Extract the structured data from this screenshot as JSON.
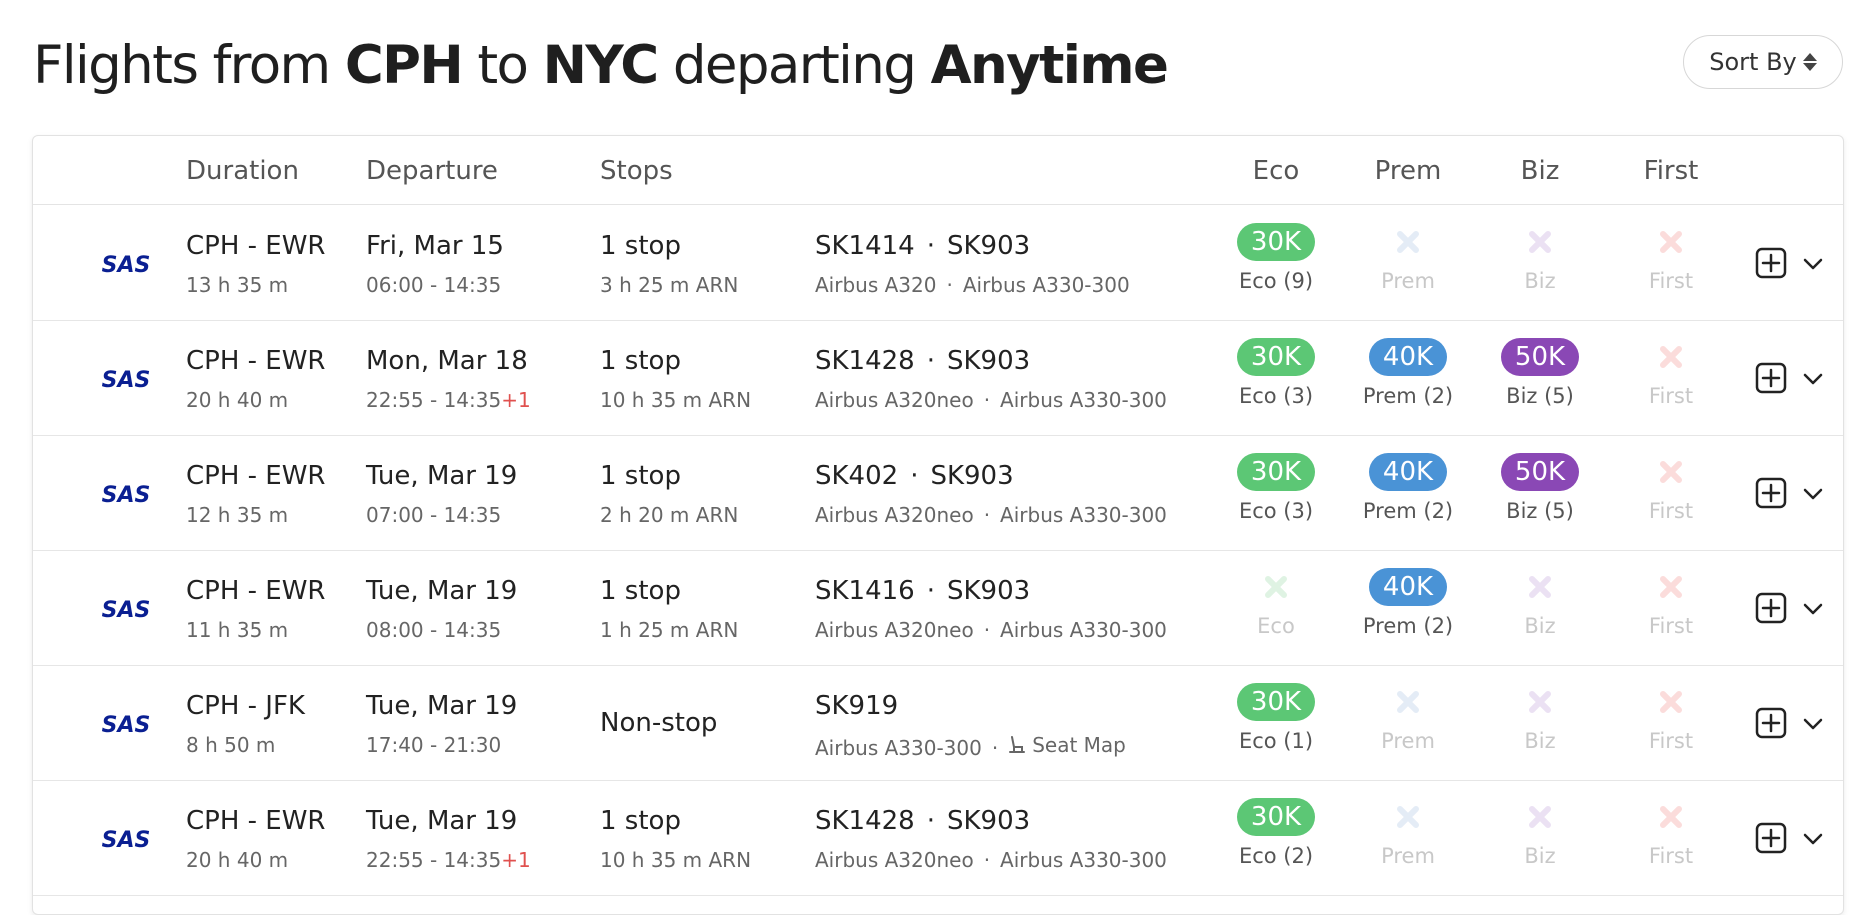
{
  "header": {
    "prefix": "Flights from",
    "origin": "CPH",
    "to": "to",
    "destination": "NYC",
    "departing": "departing",
    "when": "Anytime"
  },
  "sort": {
    "label": "Sort By"
  },
  "columns": {
    "duration": "Duration",
    "departure": "Departure",
    "stops": "Stops",
    "eco": "Eco",
    "prem": "Prem",
    "biz": "Biz",
    "first": "First"
  },
  "colors": {
    "eco": "#5cc775",
    "prem": "#4a93d6",
    "biz": "#8a48b5",
    "first": "#f2a3a0",
    "airline": "#0a1f92"
  },
  "airline_logo": "SAS",
  "rows": [
    {
      "route": "CPH - EWR",
      "duration": "13 h 35 m",
      "date": "Fri, Mar 15",
      "times": "06:00 - 14:35",
      "next_day": "",
      "stops": "1 stop",
      "layover": "3 h 25 m ARN",
      "flight1": "SK1414",
      "flight2": "SK903",
      "aircraft1": "Airbus A320",
      "aircraft2": "Airbus A330-300",
      "eco": {
        "points": "30K",
        "label": "Eco (9)"
      },
      "prem": {
        "points": "",
        "label": "Prem"
      },
      "biz": {
        "points": "",
        "label": "Biz"
      },
      "first": {
        "points": "",
        "label": "First"
      }
    },
    {
      "route": "CPH - EWR",
      "duration": "20 h 40 m",
      "date": "Mon, Mar 18",
      "times": "22:55 - 14:35",
      "next_day": "+1",
      "stops": "1 stop",
      "layover": "10 h 35 m ARN",
      "flight1": "SK1428",
      "flight2": "SK903",
      "aircraft1": "Airbus A320neo",
      "aircraft2": "Airbus A330-300",
      "eco": {
        "points": "30K",
        "label": "Eco (3)"
      },
      "prem": {
        "points": "40K",
        "label": "Prem (2)"
      },
      "biz": {
        "points": "50K",
        "label": "Biz (5)"
      },
      "first": {
        "points": "",
        "label": "First"
      }
    },
    {
      "route": "CPH - EWR",
      "duration": "12 h 35 m",
      "date": "Tue, Mar 19",
      "times": "07:00 - 14:35",
      "next_day": "",
      "stops": "1 stop",
      "layover": "2 h 20 m ARN",
      "flight1": "SK402",
      "flight2": "SK903",
      "aircraft1": "Airbus A320neo",
      "aircraft2": "Airbus A330-300",
      "eco": {
        "points": "30K",
        "label": "Eco (3)"
      },
      "prem": {
        "points": "40K",
        "label": "Prem (2)"
      },
      "biz": {
        "points": "50K",
        "label": "Biz (5)"
      },
      "first": {
        "points": "",
        "label": "First"
      }
    },
    {
      "route": "CPH - EWR",
      "duration": "11 h 35 m",
      "date": "Tue, Mar 19",
      "times": "08:00 - 14:35",
      "next_day": "",
      "stops": "1 stop",
      "layover": "1 h 25 m ARN",
      "flight1": "SK1416",
      "flight2": "SK903",
      "aircraft1": "Airbus A320neo",
      "aircraft2": "Airbus A330-300",
      "eco": {
        "points": "",
        "label": "Eco"
      },
      "prem": {
        "points": "40K",
        "label": "Prem (2)"
      },
      "biz": {
        "points": "",
        "label": "Biz"
      },
      "first": {
        "points": "",
        "label": "First"
      }
    },
    {
      "route": "CPH - JFK",
      "duration": "8 h 50 m",
      "date": "Tue, Mar 19",
      "times": "17:40 - 21:30",
      "next_day": "",
      "stops": "Non-stop",
      "layover": "",
      "flight1": "SK919",
      "flight2": "",
      "aircraft1": "Airbus A330-300",
      "aircraft2": "",
      "seat_map": "Seat Map",
      "eco": {
        "points": "30K",
        "label": "Eco (1)"
      },
      "prem": {
        "points": "",
        "label": "Prem"
      },
      "biz": {
        "points": "",
        "label": "Biz"
      },
      "first": {
        "points": "",
        "label": "First"
      }
    },
    {
      "route": "CPH - EWR",
      "duration": "20 h 40 m",
      "date": "Tue, Mar 19",
      "times": "22:55 - 14:35",
      "next_day": "+1",
      "stops": "1 stop",
      "layover": "10 h 35 m ARN",
      "flight1": "SK1428",
      "flight2": "SK903",
      "aircraft1": "Airbus A320neo",
      "aircraft2": "Airbus A330-300",
      "eco": {
        "points": "30K",
        "label": "Eco (2)"
      },
      "prem": {
        "points": "",
        "label": "Prem"
      },
      "biz": {
        "points": "",
        "label": "Biz"
      },
      "first": {
        "points": "",
        "label": "First"
      }
    }
  ]
}
